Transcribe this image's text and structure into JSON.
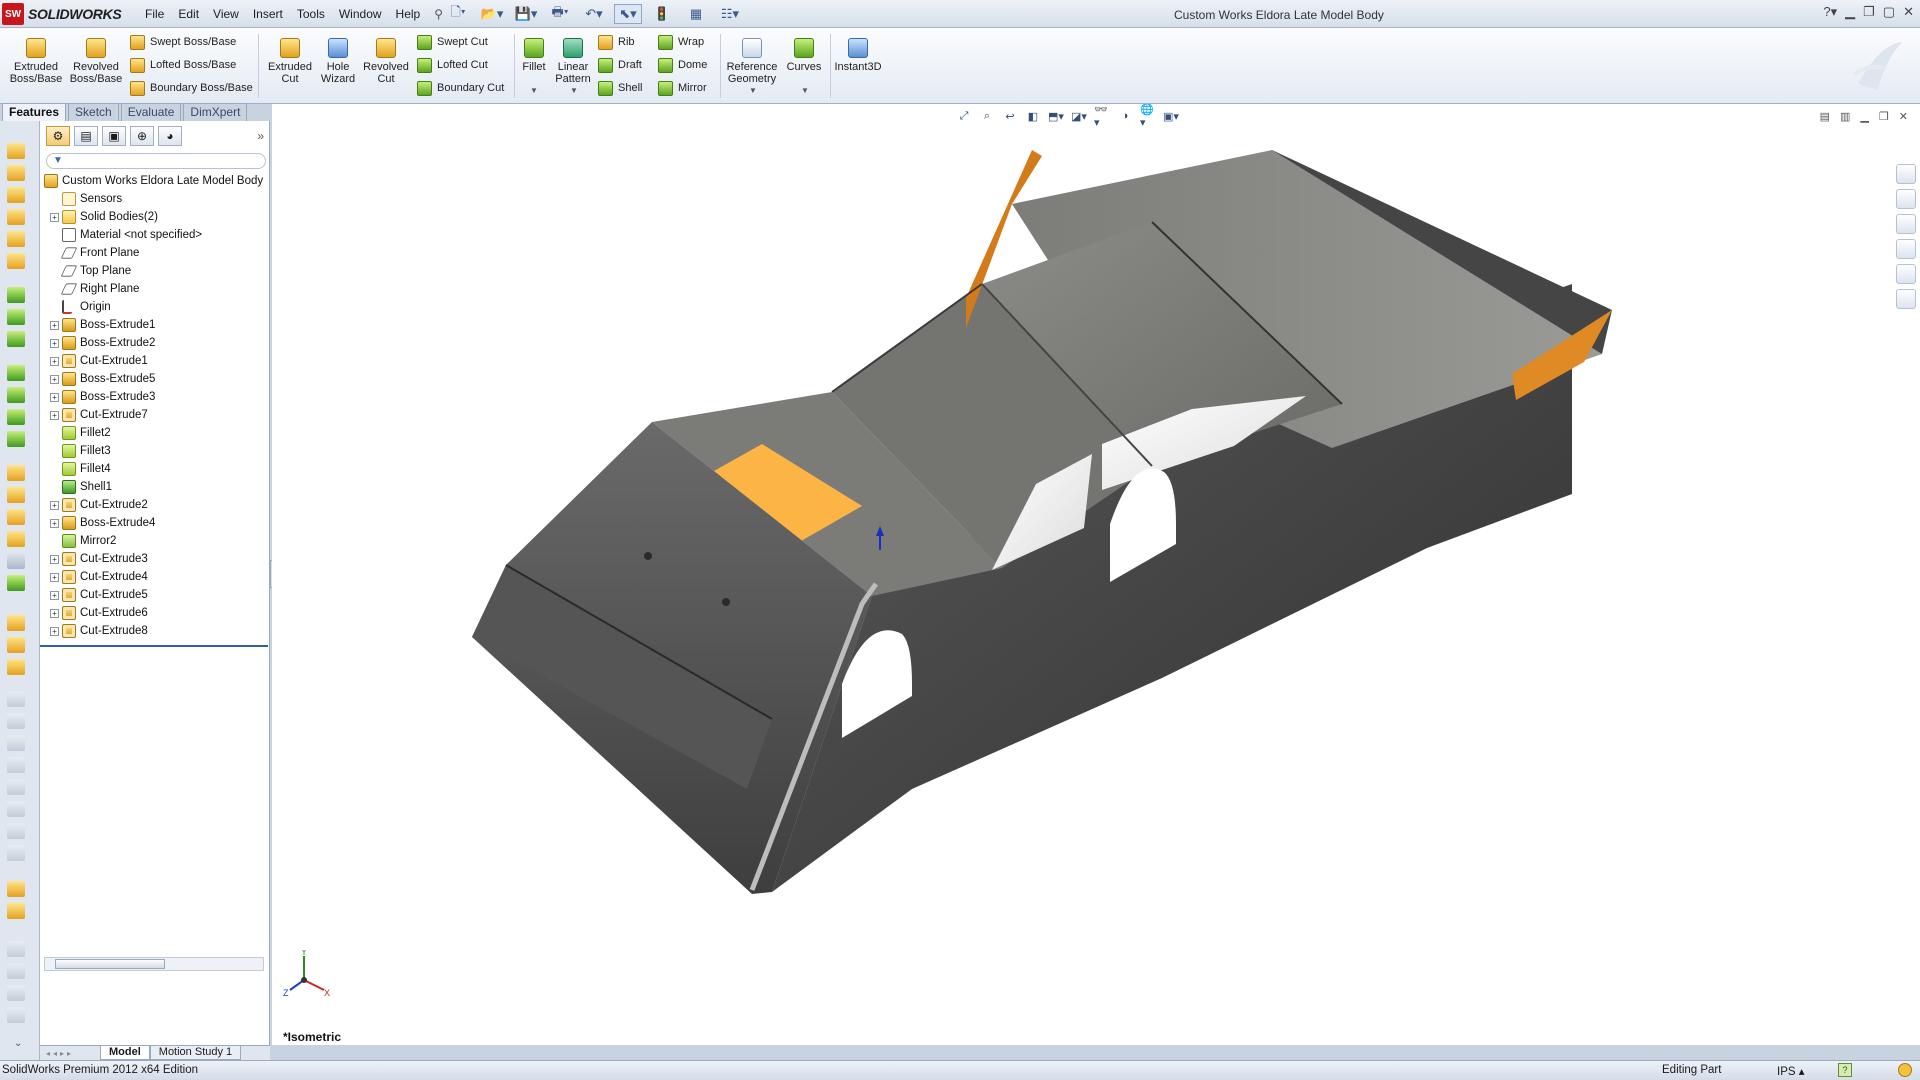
{
  "app": {
    "brand": "SOLIDWORKS",
    "brand_mark": "SW",
    "document_title": "Custom Works Eldora Late Model Body"
  },
  "menu": [
    "File",
    "Edit",
    "View",
    "Insert",
    "Tools",
    "Window",
    "Help"
  ],
  "commands": {
    "extruded_boss": "Extruded Boss/Base",
    "revolved_boss": "Revolved Boss/Base",
    "swept_boss": "Swept Boss/Base",
    "lofted_boss": "Lofted Boss/Base",
    "boundary_boss": "Boundary Boss/Base",
    "extruded_cut": "Extruded Cut",
    "hole_wizard": "Hole Wizard",
    "revolved_cut": "Revolved Cut",
    "swept_cut": "Swept Cut",
    "lofted_cut": "Lofted Cut",
    "boundary_cut": "Boundary Cut",
    "fillet": "Fillet",
    "linear_pattern": "Linear Pattern",
    "rib": "Rib",
    "draft": "Draft",
    "shell": "Shell",
    "wrap": "Wrap",
    "dome": "Dome",
    "mirror": "Mirror",
    "reference_geometry": "Reference Geometry",
    "curves": "Curves",
    "instant3d": "Instant3D"
  },
  "tabs": [
    "Features",
    "Sketch",
    "Evaluate",
    "DimXpert"
  ],
  "tree": [
    {
      "label": "Custom Works Eldora Late Model Body",
      "icon": "part-icon",
      "indent": 0,
      "expandable": false
    },
    {
      "label": "Sensors",
      "icon": "sensor-icon",
      "indent": 1,
      "expandable": false
    },
    {
      "label": "Solid Bodies(2)",
      "icon": "folder-icon",
      "indent": 1,
      "expandable": true
    },
    {
      "label": "Material <not specified>",
      "icon": "material-icon",
      "indent": 1,
      "expandable": false
    },
    {
      "label": "Front Plane",
      "icon": "plane-icon",
      "indent": 1,
      "expandable": false
    },
    {
      "label": "Top Plane",
      "icon": "plane-icon",
      "indent": 1,
      "expandable": false
    },
    {
      "label": "Right Plane",
      "icon": "plane-icon",
      "indent": 1,
      "expandable": false
    },
    {
      "label": "Origin",
      "icon": "origin-icon",
      "indent": 1,
      "expandable": false
    },
    {
      "label": "Boss-Extrude1",
      "icon": "extrude-icon",
      "indent": 1,
      "expandable": true
    },
    {
      "label": "Boss-Extrude2",
      "icon": "extrude-icon",
      "indent": 1,
      "expandable": true
    },
    {
      "label": "Cut-Extrude1",
      "icon": "cut-icon",
      "indent": 1,
      "expandable": true
    },
    {
      "label": "Boss-Extrude5",
      "icon": "extrude-icon",
      "indent": 1,
      "expandable": true
    },
    {
      "label": "Boss-Extrude3",
      "icon": "extrude-icon",
      "indent": 1,
      "expandable": true
    },
    {
      "label": "Cut-Extrude7",
      "icon": "cut-icon",
      "indent": 1,
      "expandable": true
    },
    {
      "label": "Fillet2",
      "icon": "fillet-icon",
      "indent": 1,
      "expandable": false
    },
    {
      "label": "Fillet3",
      "icon": "fillet-icon",
      "indent": 1,
      "expandable": false
    },
    {
      "label": "Fillet4",
      "icon": "fillet-icon",
      "indent": 1,
      "expandable": false
    },
    {
      "label": "Shell1",
      "icon": "shell-icon",
      "indent": 1,
      "expandable": false
    },
    {
      "label": "Cut-Extrude2",
      "icon": "cut-icon",
      "indent": 1,
      "expandable": true
    },
    {
      "label": "Boss-Extrude4",
      "icon": "extrude-icon",
      "indent": 1,
      "expandable": true
    },
    {
      "label": "Mirror2",
      "icon": "mirror-icon",
      "indent": 1,
      "expandable": false
    },
    {
      "label": "Cut-Extrude3",
      "icon": "cut-icon",
      "indent": 1,
      "expandable": true
    },
    {
      "label": "Cut-Extrude4",
      "icon": "cut-icon",
      "indent": 1,
      "expandable": true
    },
    {
      "label": "Cut-Extrude5",
      "icon": "cut-icon",
      "indent": 1,
      "expandable": true
    },
    {
      "label": "Cut-Extrude6",
      "icon": "cut-icon",
      "indent": 1,
      "expandable": true
    },
    {
      "label": "Cut-Extrude8",
      "icon": "cut-icon",
      "indent": 1,
      "expandable": true
    }
  ],
  "model_tabs": [
    "Model",
    "Motion Study 1"
  ],
  "viewport": {
    "view_name": "*Isometric",
    "triad_axes": [
      "Y",
      "Z",
      "X"
    ]
  },
  "status": {
    "edition": "SolidWorks Premium 2012 x64 Edition",
    "mode": "Editing Part",
    "units": "IPS"
  },
  "colors": {
    "accent_orange": "#ff9a2a",
    "body_gray": "#4a4a4a",
    "selection_yellow": "#fcb444"
  }
}
